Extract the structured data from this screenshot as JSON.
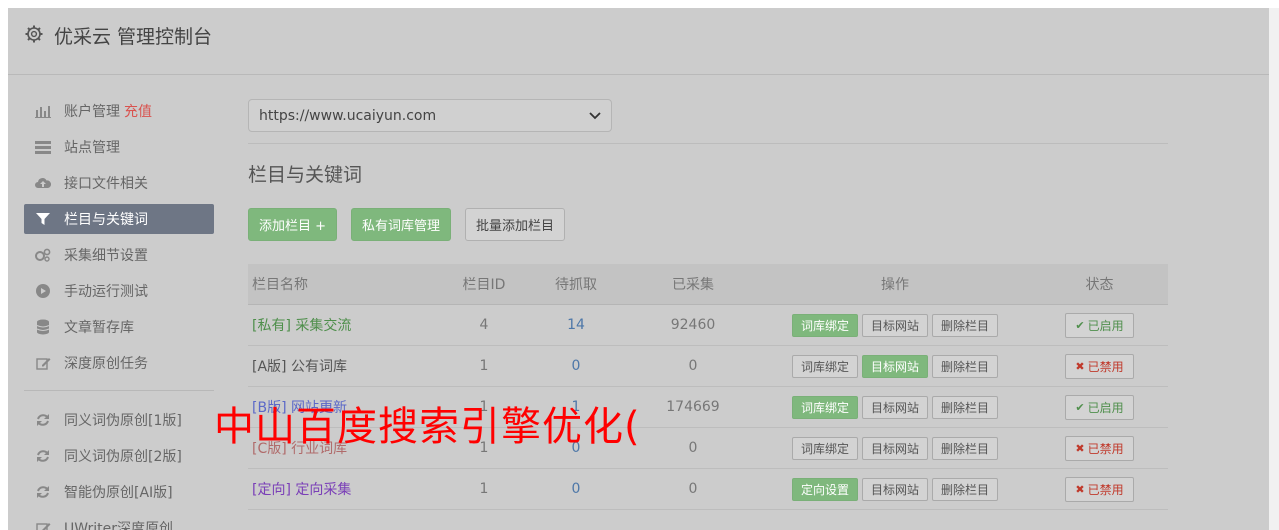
{
  "header": {
    "title": "优采云 管理控制台"
  },
  "sidebar": {
    "items": [
      {
        "label": "账户管理",
        "extra": "充值",
        "icon": "bar-chart-icon"
      },
      {
        "label": "站点管理",
        "icon": "server-icon"
      },
      {
        "label": "接口文件相关",
        "icon": "cloud-upload-icon"
      },
      {
        "label": "栏目与关键词",
        "icon": "filter-icon",
        "active": true
      },
      {
        "label": "采集细节设置",
        "icon": "cogs-icon"
      },
      {
        "label": "手动运行测试",
        "icon": "play-circle-icon"
      },
      {
        "label": "文章暂存库",
        "icon": "database-icon"
      },
      {
        "label": "深度原创任务",
        "icon": "edit-icon"
      }
    ],
    "items2": [
      {
        "label": "同义词伪原创[1版]",
        "icon": "refresh-icon"
      },
      {
        "label": "同义词伪原创[2版]",
        "icon": "refresh-icon"
      },
      {
        "label": "智能伪原创[AI版]",
        "icon": "refresh-icon"
      },
      {
        "label": "UWriter深度原创",
        "icon": "edit-icon"
      }
    ]
  },
  "main": {
    "site_select": "https://www.ucaiyun.com",
    "section_title": "栏目与关键词",
    "buttons": {
      "add": "添加栏目 +",
      "private_lib": "私有词库管理",
      "batch_add": "批量添加栏目"
    },
    "table": {
      "headers": {
        "name": "栏目名称",
        "id": "栏目ID",
        "pending": "待抓取",
        "collected": "已采集",
        "ops": "操作",
        "status": "状态"
      },
      "rows": [
        {
          "tag": "[私有]",
          "name": "采集交流",
          "id": "4",
          "pending": "14",
          "collected": "92460",
          "op1": "词库绑定",
          "op2": "目标网站",
          "op3": "删除栏目",
          "status": "已启用"
        },
        {
          "tag": "[A版]",
          "name": "公有词库",
          "id": "1",
          "pending": "0",
          "collected": "0",
          "op1": "词库绑定",
          "op2": "目标网站",
          "op3": "删除栏目",
          "status": "已禁用"
        },
        {
          "tag": "[B版]",
          "name": "网站更新",
          "id": "1",
          "pending": "1",
          "collected": "174669",
          "op1": "词库绑定",
          "op2": "目标网站",
          "op3": "删除栏目",
          "status": "已启用"
        },
        {
          "tag": "[C版]",
          "name": "行业词库",
          "id": "1",
          "pending": "0",
          "collected": "0",
          "op1": "词库绑定",
          "op2": "目标网站",
          "op3": "删除栏目",
          "status": "已禁用"
        },
        {
          "tag": "[定向]",
          "name": "定向采集",
          "id": "1",
          "pending": "0",
          "collected": "0",
          "op1": "定向设置",
          "op2": "目标网站",
          "op3": "删除栏目",
          "status": "已禁用"
        }
      ]
    }
  },
  "watermark": "中山百度搜索引擎优化(",
  "colors": {
    "accent_green": "#7fb87d",
    "active_nav": "#6e7685",
    "danger": "#d9534f",
    "link_blue": "#4d77a8"
  }
}
